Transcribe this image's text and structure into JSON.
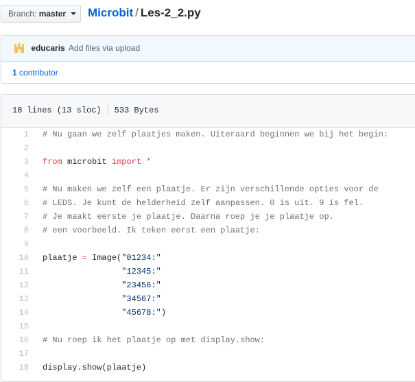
{
  "branch": {
    "label": "Branch:",
    "name": "master"
  },
  "breadcrumb": {
    "repo": "Microbit",
    "separator": "/",
    "file": "Les-2_2.py"
  },
  "commit": {
    "author": "educaris",
    "message": "Add files via upload"
  },
  "contributors": {
    "count": "1",
    "label": "contributor"
  },
  "file_info": {
    "lines": "18 lines (13 sloc)",
    "size": "533 Bytes"
  },
  "code_lines": [
    {
      "n": "1",
      "parts": [
        {
          "t": "# Nu gaan we zelf plaatjes maken. Uiteraard beginnen we bij het begin:",
          "c": "com"
        }
      ]
    },
    {
      "n": "2",
      "parts": []
    },
    {
      "n": "3",
      "parts": [
        {
          "t": "from",
          "c": "kw"
        },
        {
          "t": " microbit ",
          "c": ""
        },
        {
          "t": "import",
          "c": "kw"
        },
        {
          "t": " ",
          "c": ""
        },
        {
          "t": "*",
          "c": "op"
        }
      ]
    },
    {
      "n": "4",
      "parts": []
    },
    {
      "n": "5",
      "parts": [
        {
          "t": "# Nu maken we zelf een plaatje. Er zijn verschillende opties voor de",
          "c": "com"
        }
      ]
    },
    {
      "n": "6",
      "parts": [
        {
          "t": "# LEDS. Je kunt de helderheid zelf aanpassen. 0 is uit. 9 is fel.",
          "c": "com"
        }
      ]
    },
    {
      "n": "7",
      "parts": [
        {
          "t": "# Je maakt eerste je plaatje. Daarna roep je je plaatje op.",
          "c": "com"
        }
      ]
    },
    {
      "n": "8",
      "parts": [
        {
          "t": "# een voorbeeld. Ik teken eerst een plaatje:",
          "c": "com"
        }
      ]
    },
    {
      "n": "9",
      "parts": []
    },
    {
      "n": "10",
      "parts": [
        {
          "t": "plaatje ",
          "c": ""
        },
        {
          "t": "=",
          "c": "op"
        },
        {
          "t": " Image(",
          "c": ""
        },
        {
          "t": "\"01234:\"",
          "c": "str"
        }
      ]
    },
    {
      "n": "11",
      "parts": [
        {
          "t": "                ",
          "c": ""
        },
        {
          "t": "\"12345:\"",
          "c": "str"
        }
      ]
    },
    {
      "n": "12",
      "parts": [
        {
          "t": "                ",
          "c": ""
        },
        {
          "t": "\"23456:\"",
          "c": "str"
        }
      ]
    },
    {
      "n": "13",
      "parts": [
        {
          "t": "                ",
          "c": ""
        },
        {
          "t": "\"34567:\"",
          "c": "str"
        }
      ]
    },
    {
      "n": "14",
      "parts": [
        {
          "t": "                ",
          "c": ""
        },
        {
          "t": "\"45678:\"",
          "c": "str"
        },
        {
          "t": ")",
          "c": ""
        }
      ]
    },
    {
      "n": "15",
      "parts": []
    },
    {
      "n": "16",
      "parts": [
        {
          "t": "# Nu roep ik het plaatje op met display.show:",
          "c": "com"
        }
      ]
    },
    {
      "n": "17",
      "parts": []
    },
    {
      "n": "18",
      "parts": [
        {
          "t": "display.show(plaatje)",
          "c": ""
        }
      ]
    }
  ]
}
